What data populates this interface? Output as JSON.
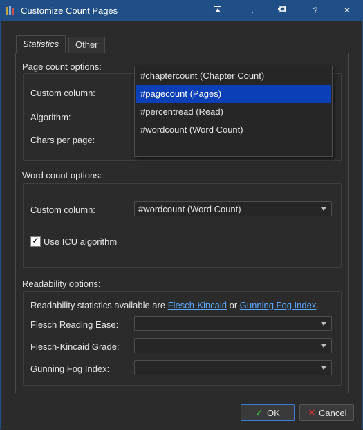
{
  "window": {
    "title": "Customize Count Pages",
    "buttons": {
      "minimize": "▁",
      "dot": ".",
      "pin": "⊣",
      "help": "?",
      "close": "✕"
    }
  },
  "tabs": [
    {
      "label": "Statistics",
      "active": true
    },
    {
      "label": "Other",
      "active": false
    }
  ],
  "page_count": {
    "section_label": "Page count options:",
    "custom_column_label": "Custom column:",
    "algorithm_label": "Algorithm:",
    "chars_per_page_label": "Chars per page:"
  },
  "dropdown_popup": {
    "items": [
      {
        "label": "#chaptercount (Chapter Count)",
        "selected": false
      },
      {
        "label": "#pagecount (Pages)",
        "selected": true
      },
      {
        "label": "#percentread (Read)",
        "selected": false
      },
      {
        "label": "#wordcount (Word Count)",
        "selected": false
      }
    ]
  },
  "word_count": {
    "section_label": "Word count options:",
    "custom_column_label": "Custom column:",
    "custom_column_value": "#wordcount (Word Count)",
    "icu_label": "Use ICU algorithm",
    "icu_checked": true
  },
  "readability": {
    "section_label": "Readability options:",
    "info_prefix": "Readability statistics available are ",
    "link1": "Flesch-Kincaid",
    "info_mid": " or ",
    "link2": "Gunning Fog Index",
    "info_suffix": ".",
    "flesch_ease_label": "Flesch Reading Ease:",
    "flesch_ease_value": "",
    "flesch_grade_label": "Flesch-Kincaid Grade:",
    "flesch_grade_value": "",
    "gunning_label": "Gunning Fog Index:",
    "gunning_value": ""
  },
  "footer": {
    "ok_label": "OK",
    "cancel_label": "Cancel"
  },
  "colors": {
    "titlebar": "#1f4f86",
    "selection": "#0b3fb8",
    "link": "#5aa7ff",
    "ok_icon": "#3cc43c",
    "cancel_icon": "#e03030"
  },
  "icons": {
    "app": "books-icon",
    "ok": "checkmark-icon",
    "cancel": "x-mark-icon"
  }
}
